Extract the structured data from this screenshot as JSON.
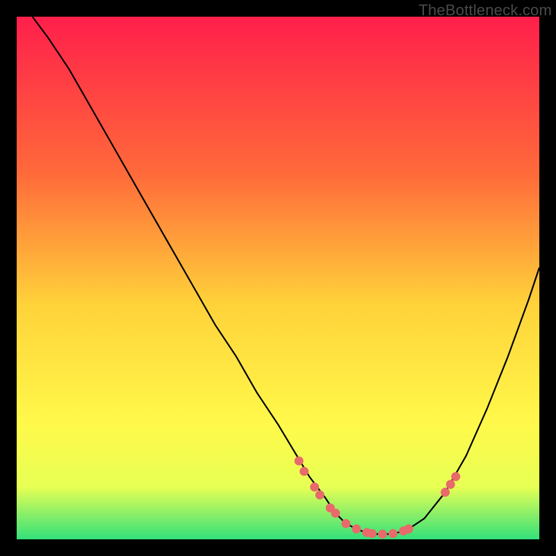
{
  "watermark": "TheBottleneck.com",
  "colors": {
    "gradient_top": "#ff1f4b",
    "gradient_mid_upper": "#ff6a3a",
    "gradient_mid": "#ffd23a",
    "gradient_mid_lower": "#fff94a",
    "gradient_lower": "#e7ff54",
    "gradient_bottom": "#33e07a",
    "curve": "#000000",
    "points": "#e86a6a",
    "frame": "#000000"
  },
  "chart_data": {
    "type": "line",
    "title": "",
    "xlabel": "",
    "ylabel": "",
    "xlim": [
      0,
      100
    ],
    "ylim": [
      0,
      100
    ],
    "series": [
      {
        "name": "bottleneck-curve",
        "x": [
          3,
          6,
          10,
          14,
          18,
          22,
          26,
          30,
          34,
          38,
          42,
          46,
          50,
          53,
          56,
          59,
          61,
          63,
          65,
          67,
          69,
          71,
          73,
          75,
          78,
          82,
          86,
          90,
          94,
          98,
          100
        ],
        "y": [
          100,
          96,
          90,
          83,
          76,
          69,
          62,
          55,
          48,
          41,
          35,
          28,
          22,
          17,
          12,
          8,
          5,
          3,
          2,
          1.2,
          1,
          1,
          1.3,
          2,
          4,
          9,
          16,
          25,
          35,
          46,
          52
        ]
      }
    ],
    "points": {
      "name": "highlighted-points",
      "x": [
        54,
        55,
        57,
        58,
        60,
        61,
        63,
        65,
        67,
        68,
        70,
        72,
        74,
        75,
        82,
        83,
        84
      ],
      "y": [
        15,
        13,
        10,
        8.5,
        6,
        5,
        3,
        2,
        1.3,
        1.1,
        1,
        1.1,
        1.6,
        2,
        9,
        10.5,
        12
      ]
    }
  }
}
